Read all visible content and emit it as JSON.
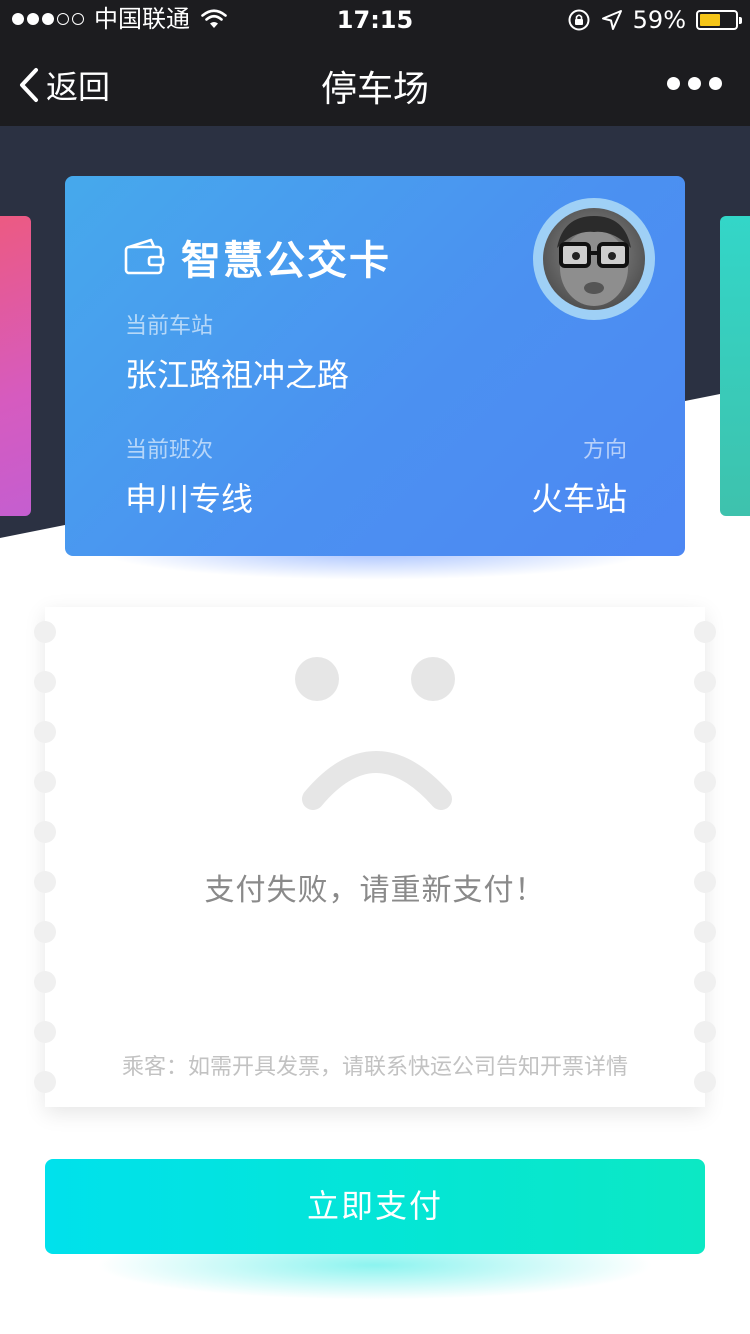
{
  "status_bar": {
    "carrier": "中国联通",
    "time": "17:15",
    "battery_percent": "59%",
    "battery_level": 0.59,
    "signal_bars": 3
  },
  "nav": {
    "back_label": "返回",
    "title": "停车场"
  },
  "card": {
    "title": "智慧公交卡",
    "station_label": "当前车站",
    "station_value": "张江路祖冲之路",
    "route_label": "当前班次",
    "route_value": "申川专线",
    "direction_label": "方向",
    "direction_value": "火车站"
  },
  "ticket": {
    "message": "支付失败，请重新支付！",
    "note": "乘客：如需开具发票，请联系快运公司告知开票详情"
  },
  "pay_button": {
    "label": "立即支付"
  },
  "colors": {
    "navbar": "#1c1c1f",
    "hero": "#2b3142",
    "card_gradient_start": "#46a9ec",
    "card_gradient_end": "#4d87f3",
    "pay_gradient_start": "#00e1ec",
    "pay_gradient_end": "#0ce8c4",
    "battery": "#f5c518"
  }
}
